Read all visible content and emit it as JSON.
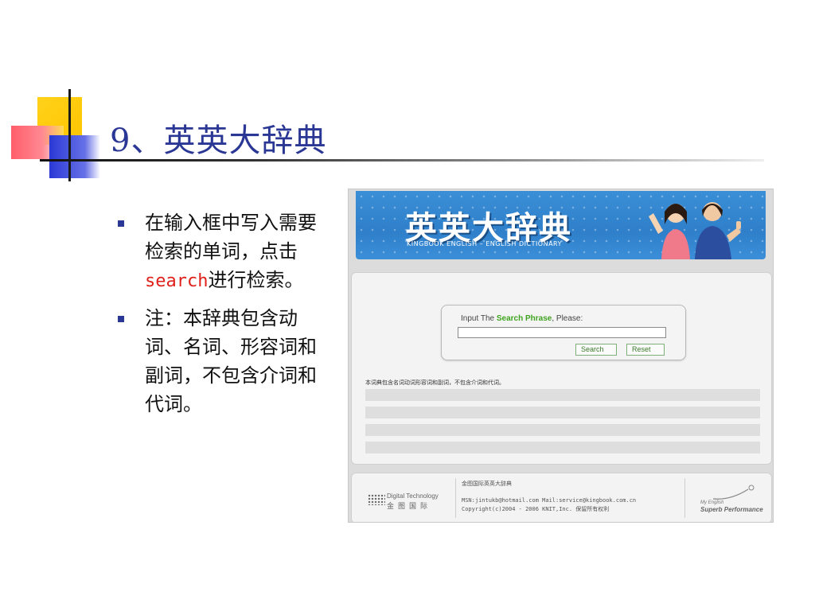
{
  "slide": {
    "title": "9、英英大辞典",
    "bullets": [
      {
        "before": "在输入框中写入需要检索的单词，点击",
        "keyword": "search",
        "after": "进行检索。"
      },
      {
        "text": "注：本辞典包含动词、名词、形容词和副词，不包含介词和代词。"
      }
    ],
    "colors": {
      "title": "#2b3794",
      "keyword": "#e0201a",
      "bullet_marker": "#2b3794",
      "deco_yellow": "#ffd21a",
      "deco_red": "#ff5d6a",
      "deco_blue": "#2a39d6"
    }
  },
  "web": {
    "banner": {
      "title": "英英大辞典",
      "subtitle": "KINGBOOK ENGLISH – ENGLISH DICTIONARY"
    },
    "search": {
      "prompt_before": "Input The ",
      "prompt_highlight": "Search Phrase",
      "prompt_after": ", Please:",
      "input_value": "",
      "search_label": "Search",
      "reset_label": "Reset"
    },
    "note": "本词典包含名词动词形容词和副词，不包含介词和代词。",
    "result_rows": 4,
    "footer": {
      "logo_en": "Digital Technology",
      "logo_cn": "金图国际",
      "name": "金图国际英英大辞典",
      "contact": "MSN:jintukb@hotmail.com  Mail:service@kingbook.com.cn",
      "copyright": "Copyright(c)2004 - 2006 KNIT,Inc. 保留所有权利",
      "brand_line1": "My English",
      "brand_line2": "Superb Performance"
    }
  }
}
